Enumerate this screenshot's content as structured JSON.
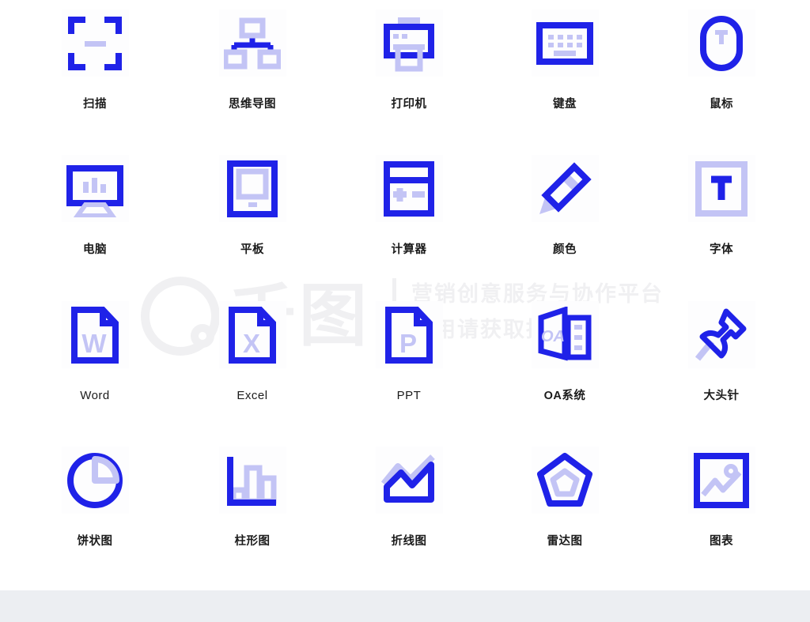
{
  "palette": {
    "primary": "#1f22e8",
    "secondary": "#c3c4f5",
    "label": "#1b1b1b",
    "tile_bg": "#fdfdfe",
    "page_bg": "#ffffff",
    "footer_bg": "#eceef2",
    "watermark": "#f0f0f2"
  },
  "watermark": {
    "brand": "千图",
    "tagline": "营销创意服务与协作平台",
    "notice": "商用请获取授权"
  },
  "grid": {
    "columns": 5,
    "rows": 4,
    "items": [
      {
        "icon": "scan-icon",
        "label": "扫描",
        "script": "cjk"
      },
      {
        "icon": "mind-map-icon",
        "label": "思维导图",
        "script": "cjk"
      },
      {
        "icon": "printer-icon",
        "label": "打印机",
        "script": "cjk"
      },
      {
        "icon": "keyboard-icon",
        "label": "键盘",
        "script": "cjk"
      },
      {
        "icon": "mouse-icon",
        "label": "鼠标",
        "script": "cjk"
      },
      {
        "icon": "computer-icon",
        "label": "电脑",
        "script": "cjk"
      },
      {
        "icon": "tablet-icon",
        "label": "平板",
        "script": "cjk"
      },
      {
        "icon": "calculator-icon",
        "label": "计算器",
        "script": "cjk"
      },
      {
        "icon": "pencil-color-icon",
        "label": "颜色",
        "script": "cjk"
      },
      {
        "icon": "font-icon",
        "label": "字体",
        "script": "cjk"
      },
      {
        "icon": "word-file-icon",
        "label": "Word",
        "script": "latin"
      },
      {
        "icon": "excel-file-icon",
        "label": "Excel",
        "script": "latin"
      },
      {
        "icon": "ppt-file-icon",
        "label": "PPT",
        "script": "latin"
      },
      {
        "icon": "oa-system-icon",
        "label": "OA系统",
        "script": "cjk"
      },
      {
        "icon": "pushpin-icon",
        "label": "大头针",
        "script": "cjk"
      },
      {
        "icon": "pie-chart-icon",
        "label": "饼状图",
        "script": "cjk"
      },
      {
        "icon": "bar-chart-icon",
        "label": "柱形图",
        "script": "cjk"
      },
      {
        "icon": "line-chart-icon",
        "label": "折线图",
        "script": "cjk"
      },
      {
        "icon": "radar-chart-icon",
        "label": "雷达图",
        "script": "cjk"
      },
      {
        "icon": "image-chart-icon",
        "label": "图表",
        "script": "cjk"
      }
    ]
  },
  "glyph_text": {
    "word_letter": "W",
    "excel_letter": "X",
    "ppt_letter": "P",
    "font_letter": "T",
    "oa_letter": "OA"
  }
}
